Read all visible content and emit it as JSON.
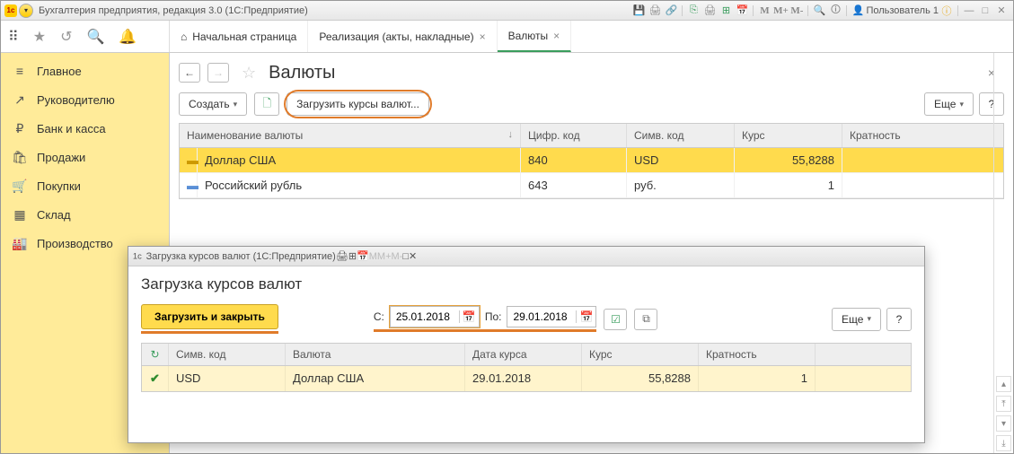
{
  "app": {
    "title": "Бухгалтерия предприятия, редакция 3.0  (1С:Предприятие)",
    "user": "Пользователь 1",
    "m_labels": [
      "M",
      "M+",
      "M-"
    ]
  },
  "tabs": [
    {
      "label": "Начальная страница",
      "closable": false,
      "icon": "home"
    },
    {
      "label": "Реализация (акты, накладные)",
      "closable": true
    },
    {
      "label": "Валюты",
      "closable": true,
      "active": true
    }
  ],
  "sidebar": [
    {
      "icon": "≡",
      "label": "Главное"
    },
    {
      "icon": "↗",
      "label": "Руководителю"
    },
    {
      "icon": "₽",
      "label": "Банк и касса"
    },
    {
      "icon": "🛍",
      "label": "Продажи"
    },
    {
      "icon": "🛒",
      "label": "Покупки"
    },
    {
      "icon": "▦",
      "label": "Склад"
    },
    {
      "icon": "🏭",
      "label": "Производство"
    }
  ],
  "page": {
    "title": "Валюты",
    "create_btn": "Создать",
    "load_btn": "Загрузить курсы валют...",
    "more_btn": "Еще",
    "help_btn": "?",
    "columns": {
      "name": "Наименование валюты",
      "num": "Цифр. код",
      "sym": "Симв. код",
      "rate": "Курс",
      "mult": "Кратность"
    },
    "rows": [
      {
        "name": "Доллар США",
        "num": "840",
        "sym": "USD",
        "rate": "55,8288",
        "mult": "",
        "sel": true
      },
      {
        "name": "Российский рубль",
        "num": "643",
        "sym": "руб.",
        "rate": "1",
        "mult": ""
      }
    ]
  },
  "dialog": {
    "title": "Загрузка курсов валют  (1С:Предприятие)",
    "heading": "Загрузка курсов валют",
    "load_close": "Загрузить и закрыть",
    "from_label": "С:",
    "from_value": "25.01.2018",
    "to_label": "По:",
    "to_value": "29.01.2018",
    "more_btn": "Еще",
    "help_btn": "?",
    "m_labels": [
      "M",
      "M+",
      "M-"
    ],
    "columns": {
      "refresh": "↻",
      "sym": "Симв. код",
      "name": "Валюта",
      "date": "Дата курса",
      "rate": "Курс",
      "mult": "Кратность"
    },
    "rows": [
      {
        "check": "✔",
        "sym": "USD",
        "name": "Доллар США",
        "date": "29.01.2018",
        "rate": "55,8288",
        "mult": "1"
      }
    ]
  }
}
